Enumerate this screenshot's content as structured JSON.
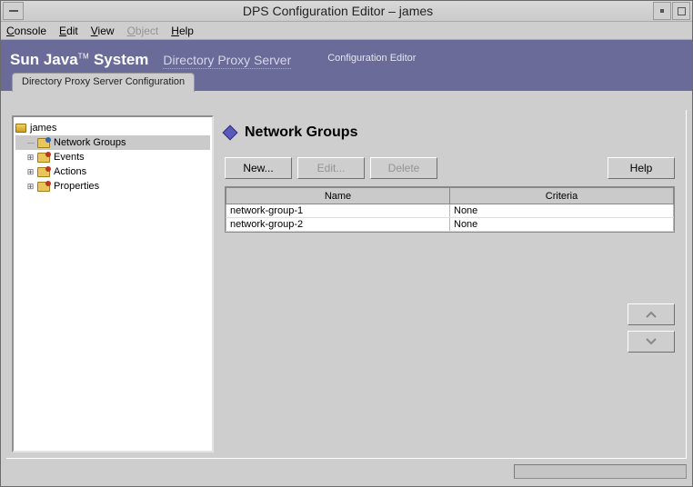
{
  "window": {
    "title": "DPS Configuration Editor – james"
  },
  "menu": {
    "items": [
      "Console",
      "Edit",
      "View",
      "Object",
      "Help"
    ],
    "disabled_index": 3
  },
  "banner": {
    "brand_prefix": "Sun Java",
    "brand_tm": "TM",
    "brand_suffix": " System",
    "product": "Directory Proxy Server",
    "subtitle": "Configuration Editor"
  },
  "tab": {
    "label": "Directory Proxy Server Configuration"
  },
  "tree": {
    "root": "james",
    "nodes": [
      {
        "label": "Network Groups",
        "selected": true,
        "expandable": false,
        "icon": "folder-blue"
      },
      {
        "label": "Events",
        "selected": false,
        "expandable": true,
        "icon": "folder-red"
      },
      {
        "label": "Actions",
        "selected": false,
        "expandable": true,
        "icon": "folder-red"
      },
      {
        "label": "Properties",
        "selected": false,
        "expandable": true,
        "icon": "folder-red"
      }
    ]
  },
  "content": {
    "heading": "Network Groups",
    "buttons": {
      "new": "New...",
      "edit": "Edit...",
      "delete": "Delete",
      "help": "Help"
    },
    "table": {
      "columns": [
        "Name",
        "Criteria"
      ],
      "rows": [
        {
          "name": "network-group-1",
          "criteria": "None"
        },
        {
          "name": "network-group-2",
          "criteria": "None"
        }
      ]
    }
  }
}
